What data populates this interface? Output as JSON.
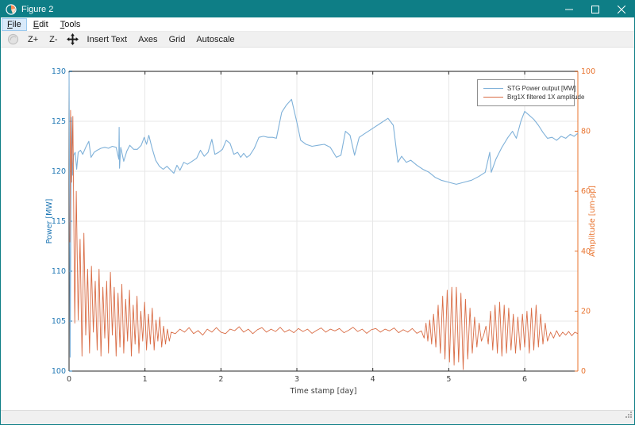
{
  "window": {
    "title": "Figure 2"
  },
  "menu": {
    "items": [
      {
        "u": "F",
        "rest": "ile"
      },
      {
        "u": "E",
        "rest": "dit"
      },
      {
        "u": "T",
        "rest": "ools"
      }
    ]
  },
  "toolbar": {
    "zoom_in": "Z+",
    "zoom_out": "Z-",
    "insert_text": "Insert Text",
    "axes": "Axes",
    "grid": "Grid",
    "autoscale": "Autoscale"
  },
  "chart_data": {
    "type": "line",
    "xlabel": "Time stamp [day]",
    "xlim": [
      0,
      6.7
    ],
    "x_ticks": [
      0,
      1,
      2,
      3,
      4,
      5,
      6
    ],
    "grid": true,
    "legend_position": "top-right",
    "colors": {
      "grid": "#e7e7e7",
      "spine": "#262626",
      "top_spine": "#8c8c8c",
      "tick_text": "#404040"
    },
    "left_axis": {
      "label": "Power [MW]",
      "lim": [
        100,
        130
      ],
      "ticks": [
        100,
        105,
        110,
        115,
        120,
        125,
        130
      ],
      "color": "#1f77b4"
    },
    "right_axis": {
      "label": "Amplitude [um-pp]",
      "lim": [
        0,
        100
      ],
      "ticks": [
        0,
        20,
        40,
        60,
        80,
        100
      ],
      "color": "#e8732e"
    },
    "series": [
      {
        "name": "STG Power output [MW]",
        "axis": "left",
        "color": "#7fb1d9",
        "points": [
          [
            0.0,
            129.9
          ],
          [
            0.015,
            101.4
          ],
          [
            0.03,
            125.4
          ],
          [
            0.045,
            119.6
          ],
          [
            0.06,
            121.6
          ],
          [
            0.08,
            121.9
          ],
          [
            0.1,
            120.2
          ],
          [
            0.12,
            121.9
          ],
          [
            0.15,
            122.1
          ],
          [
            0.18,
            121.7
          ],
          [
            0.22,
            122.4
          ],
          [
            0.26,
            123.0
          ],
          [
            0.29,
            121.4
          ],
          [
            0.33,
            121.9
          ],
          [
            0.37,
            122.1
          ],
          [
            0.42,
            122.3
          ],
          [
            0.47,
            122.4
          ],
          [
            0.52,
            122.3
          ],
          [
            0.57,
            122.5
          ],
          [
            0.62,
            122.4
          ],
          [
            0.655,
            121.2
          ],
          [
            0.66,
            124.4
          ],
          [
            0.665,
            120.3
          ],
          [
            0.68,
            122.4
          ],
          [
            0.72,
            121.0
          ],
          [
            0.76,
            122.0
          ],
          [
            0.8,
            122.6
          ],
          [
            0.85,
            122.2
          ],
          [
            0.9,
            122.2
          ],
          [
            0.95,
            122.6
          ],
          [
            0.99,
            123.4
          ],
          [
            1.02,
            122.7
          ],
          [
            1.05,
            123.6
          ],
          [
            1.09,
            122.4
          ],
          [
            1.14,
            121.1
          ],
          [
            1.19,
            120.5
          ],
          [
            1.24,
            120.2
          ],
          [
            1.29,
            120.5
          ],
          [
            1.34,
            120.1
          ],
          [
            1.38,
            119.8
          ],
          [
            1.42,
            120.6
          ],
          [
            1.46,
            120.1
          ],
          [
            1.51,
            120.9
          ],
          [
            1.56,
            120.7
          ],
          [
            1.62,
            121.0
          ],
          [
            1.68,
            121.3
          ],
          [
            1.73,
            122.1
          ],
          [
            1.78,
            121.5
          ],
          [
            1.83,
            121.9
          ],
          [
            1.88,
            123.2
          ],
          [
            1.92,
            121.7
          ],
          [
            1.97,
            121.9
          ],
          [
            2.02,
            122.2
          ],
          [
            2.07,
            123.1
          ],
          [
            2.12,
            122.8
          ],
          [
            2.17,
            121.7
          ],
          [
            2.22,
            121.9
          ],
          [
            2.26,
            121.4
          ],
          [
            2.3,
            121.8
          ],
          [
            2.34,
            121.4
          ],
          [
            2.38,
            121.6
          ],
          [
            2.44,
            122.3
          ],
          [
            2.5,
            123.4
          ],
          [
            2.56,
            123.5
          ],
          [
            2.62,
            123.4
          ],
          [
            2.68,
            123.4
          ],
          [
            2.73,
            123.3
          ],
          [
            2.8,
            125.9
          ],
          [
            2.86,
            126.6
          ],
          [
            2.93,
            127.2
          ],
          [
            3.0,
            124.9
          ],
          [
            3.05,
            123.1
          ],
          [
            3.12,
            122.7
          ],
          [
            3.2,
            122.5
          ],
          [
            3.28,
            122.6
          ],
          [
            3.36,
            122.7
          ],
          [
            3.44,
            122.4
          ],
          [
            3.52,
            121.4
          ],
          [
            3.58,
            121.6
          ],
          [
            3.64,
            124.0
          ],
          [
            3.7,
            123.6
          ],
          [
            3.76,
            121.6
          ],
          [
            3.82,
            123.4
          ],
          [
            3.9,
            123.8
          ],
          [
            4.0,
            124.3
          ],
          [
            4.1,
            124.8
          ],
          [
            4.2,
            125.3
          ],
          [
            4.27,
            124.6
          ],
          [
            4.33,
            120.9
          ],
          [
            4.38,
            121.5
          ],
          [
            4.44,
            120.9
          ],
          [
            4.5,
            121.1
          ],
          [
            4.58,
            120.6
          ],
          [
            4.66,
            120.2
          ],
          [
            4.74,
            119.9
          ],
          [
            4.82,
            119.4
          ],
          [
            4.9,
            119.1
          ],
          [
            5.0,
            118.9
          ],
          [
            5.1,
            118.7
          ],
          [
            5.2,
            118.9
          ],
          [
            5.3,
            119.1
          ],
          [
            5.4,
            119.5
          ],
          [
            5.48,
            119.9
          ],
          [
            5.54,
            121.9
          ],
          [
            5.56,
            119.9
          ],
          [
            5.62,
            121.2
          ],
          [
            5.7,
            122.4
          ],
          [
            5.78,
            123.4
          ],
          [
            5.84,
            124.0
          ],
          [
            5.89,
            123.3
          ],
          [
            5.95,
            125.0
          ],
          [
            6.0,
            126.0
          ],
          [
            6.06,
            125.6
          ],
          [
            6.12,
            125.2
          ],
          [
            6.18,
            124.6
          ],
          [
            6.24,
            123.9
          ],
          [
            6.3,
            123.3
          ],
          [
            6.36,
            123.4
          ],
          [
            6.42,
            123.1
          ],
          [
            6.48,
            123.5
          ],
          [
            6.54,
            123.3
          ],
          [
            6.6,
            123.7
          ],
          [
            6.65,
            123.5
          ],
          [
            6.7,
            123.8
          ]
        ]
      },
      {
        "name": "Brg1X filtered 1X amplitude",
        "axis": "right",
        "color": "#d96c45",
        "points": [
          [
            0.01,
            43
          ],
          [
            0.02,
            87
          ],
          [
            0.035,
            63
          ],
          [
            0.05,
            85
          ],
          [
            0.075,
            16
          ],
          [
            0.095,
            60
          ],
          [
            0.12,
            17
          ],
          [
            0.145,
            44
          ],
          [
            0.17,
            5
          ],
          [
            0.195,
            46
          ],
          [
            0.22,
            12
          ],
          [
            0.245,
            34
          ],
          [
            0.27,
            6
          ],
          [
            0.295,
            35
          ],
          [
            0.32,
            13
          ],
          [
            0.345,
            30
          ],
          [
            0.37,
            7
          ],
          [
            0.395,
            34
          ],
          [
            0.42,
            5
          ],
          [
            0.445,
            28
          ],
          [
            0.47,
            11
          ],
          [
            0.495,
            30
          ],
          [
            0.52,
            6
          ],
          [
            0.545,
            33
          ],
          [
            0.57,
            12
          ],
          [
            0.595,
            28
          ],
          [
            0.62,
            5
          ],
          [
            0.645,
            26
          ],
          [
            0.67,
            8
          ],
          [
            0.695,
            29
          ],
          [
            0.72,
            6
          ],
          [
            0.745,
            24
          ],
          [
            0.77,
            10
          ],
          [
            0.795,
            27
          ],
          [
            0.82,
            5
          ],
          [
            0.845,
            22
          ],
          [
            0.87,
            9
          ],
          [
            0.895,
            25
          ],
          [
            0.92,
            6
          ],
          [
            0.945,
            20
          ],
          [
            0.97,
            10
          ],
          [
            0.995,
            23
          ],
          [
            1.02,
            7
          ],
          [
            1.045,
            19
          ],
          [
            1.07,
            9
          ],
          [
            1.095,
            21
          ],
          [
            1.12,
            7
          ],
          [
            1.145,
            17
          ],
          [
            1.17,
            10
          ],
          [
            1.195,
            18
          ],
          [
            1.22,
            8
          ],
          [
            1.245,
            15
          ],
          [
            1.27,
            9
          ],
          [
            1.295,
            14
          ],
          [
            1.32,
            10
          ],
          [
            1.345,
            13
          ],
          [
            1.4,
            12.5
          ],
          [
            1.46,
            14
          ],
          [
            1.52,
            13
          ],
          [
            1.58,
            14.5
          ],
          [
            1.64,
            12.5
          ],
          [
            1.7,
            13.5
          ],
          [
            1.76,
            12
          ],
          [
            1.82,
            14
          ],
          [
            1.88,
            13
          ],
          [
            1.94,
            14.5
          ],
          [
            2.0,
            13
          ],
          [
            2.06,
            12.5
          ],
          [
            2.12,
            14
          ],
          [
            2.18,
            13.5
          ],
          [
            2.24,
            14.8
          ],
          [
            2.3,
            13
          ],
          [
            2.36,
            14
          ],
          [
            2.42,
            12.5
          ],
          [
            2.48,
            13.8
          ],
          [
            2.54,
            14.5
          ],
          [
            2.6,
            13
          ],
          [
            2.66,
            14
          ],
          [
            2.72,
            13.2
          ],
          [
            2.78,
            14.6
          ],
          [
            2.84,
            13
          ],
          [
            2.9,
            13.8
          ],
          [
            2.96,
            12.8
          ],
          [
            3.02,
            14.2
          ],
          [
            3.08,
            13.2
          ],
          [
            3.14,
            14
          ],
          [
            3.2,
            12.6
          ],
          [
            3.26,
            13.6
          ],
          [
            3.32,
            14.4
          ],
          [
            3.38,
            13
          ],
          [
            3.44,
            14
          ],
          [
            3.5,
            13.4
          ],
          [
            3.56,
            14.2
          ],
          [
            3.62,
            12.8
          ],
          [
            3.68,
            13.6
          ],
          [
            3.74,
            14.6
          ],
          [
            3.8,
            13.2
          ],
          [
            3.86,
            14
          ],
          [
            3.92,
            12.6
          ],
          [
            3.98,
            13.8
          ],
          [
            4.04,
            14.2
          ],
          [
            4.1,
            13
          ],
          [
            4.16,
            14
          ],
          [
            4.22,
            13.4
          ],
          [
            4.28,
            14.4
          ],
          [
            4.34,
            12.8
          ],
          [
            4.4,
            13.8
          ],
          [
            4.46,
            13
          ],
          [
            4.52,
            14.2
          ],
          [
            4.58,
            12.6
          ],
          [
            4.64,
            13.4
          ],
          [
            4.675,
            11
          ],
          [
            4.7,
            16
          ],
          [
            4.725,
            10
          ],
          [
            4.75,
            17
          ],
          [
            4.775,
            9
          ],
          [
            4.8,
            19
          ],
          [
            4.83,
            8
          ],
          [
            4.86,
            22
          ],
          [
            4.89,
            6
          ],
          [
            4.92,
            25
          ],
          [
            4.95,
            4
          ],
          [
            4.98,
            27
          ],
          [
            5.01,
            3
          ],
          [
            5.04,
            28
          ],
          [
            5.07,
            2
          ],
          [
            5.1,
            28
          ],
          [
            5.13,
            3
          ],
          [
            5.16,
            26
          ],
          [
            5.19,
            0.5
          ],
          [
            5.22,
            24
          ],
          [
            5.25,
            4
          ],
          [
            5.28,
            21
          ],
          [
            5.31,
            6
          ],
          [
            5.34,
            18
          ],
          [
            5.37,
            8
          ],
          [
            5.4,
            16
          ],
          [
            5.43,
            10
          ],
          [
            5.46,
            12
          ],
          [
            5.49,
            15
          ],
          [
            5.52,
            9
          ],
          [
            5.55,
            20
          ],
          [
            5.58,
            7
          ],
          [
            5.61,
            22
          ],
          [
            5.64,
            6
          ],
          [
            5.67,
            23
          ],
          [
            5.7,
            5
          ],
          [
            5.73,
            22
          ],
          [
            5.76,
            6
          ],
          [
            5.79,
            21
          ],
          [
            5.82,
            7
          ],
          [
            5.85,
            19
          ],
          [
            5.88,
            6
          ],
          [
            5.91,
            18
          ],
          [
            5.94,
            7
          ],
          [
            5.97,
            19
          ],
          [
            6.0,
            8
          ],
          [
            6.03,
            20
          ],
          [
            6.06,
            6
          ],
          [
            6.09,
            21
          ],
          [
            6.12,
            7
          ],
          [
            6.15,
            22
          ],
          [
            6.18,
            8
          ],
          [
            6.21,
            19
          ],
          [
            6.24,
            9
          ],
          [
            6.27,
            16
          ],
          [
            6.3,
            10
          ],
          [
            6.34,
            13
          ],
          [
            6.38,
            11
          ],
          [
            6.42,
            13.5
          ],
          [
            6.46,
            11.5
          ],
          [
            6.5,
            13
          ],
          [
            6.54,
            12
          ],
          [
            6.58,
            13.2
          ],
          [
            6.62,
            11.8
          ],
          [
            6.66,
            13
          ],
          [
            6.7,
            12.5
          ]
        ]
      }
    ]
  }
}
